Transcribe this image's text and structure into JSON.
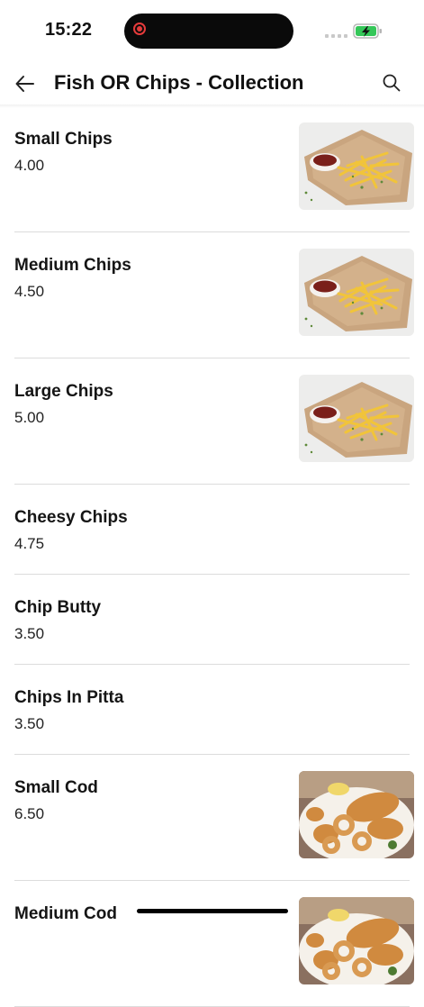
{
  "status_bar": {
    "time": "15:22"
  },
  "header": {
    "title": "Fish OR Chips - Collection",
    "back_icon": "arrow-left-icon",
    "search_icon": "search-icon"
  },
  "colors": {
    "recording": "#e63b3b",
    "battery_green": "#35c759",
    "divider": "#dcdcdc"
  },
  "items": [
    {
      "name": "Small Chips",
      "price": "4.00",
      "image": "chips-photo"
    },
    {
      "name": "Medium Chips",
      "price": "4.50",
      "image": "chips-photo"
    },
    {
      "name": "Large Chips",
      "price": "5.00",
      "image": "chips-photo"
    },
    {
      "name": "Cheesy Chips",
      "price": "4.75",
      "image": ""
    },
    {
      "name": "Chip Butty",
      "price": "3.50",
      "image": ""
    },
    {
      "name": "Chips In Pitta",
      "price": "3.50",
      "image": ""
    },
    {
      "name": "Small Cod",
      "price": "6.50",
      "image": "fried-fish-photo"
    },
    {
      "name": "Medium Cod",
      "price": "",
      "image": "fried-fish-photo"
    }
  ]
}
